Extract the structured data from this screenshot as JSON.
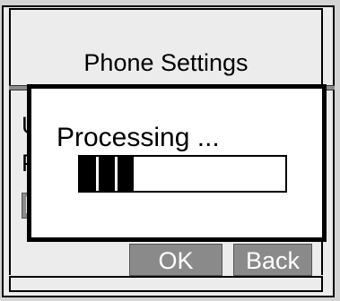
{
  "window": {
    "title": "Phone Settings"
  },
  "menu": {
    "items": [
      {
        "label": "U",
        "selected": false
      },
      {
        "label": "P",
        "selected": false
      },
      {
        "label": "P",
        "selected": true
      }
    ]
  },
  "softkeys": {
    "ok_label": "OK",
    "back_label": "Back"
  },
  "dialog": {
    "message": "Processing ...",
    "progress_fraction": 0.26,
    "progress_segments": 3
  },
  "colors": {
    "softkey_bg": "#8a8a8a",
    "screen_bg": "#ececec",
    "dialog_bg": "#ffffff",
    "border": "#000000"
  }
}
